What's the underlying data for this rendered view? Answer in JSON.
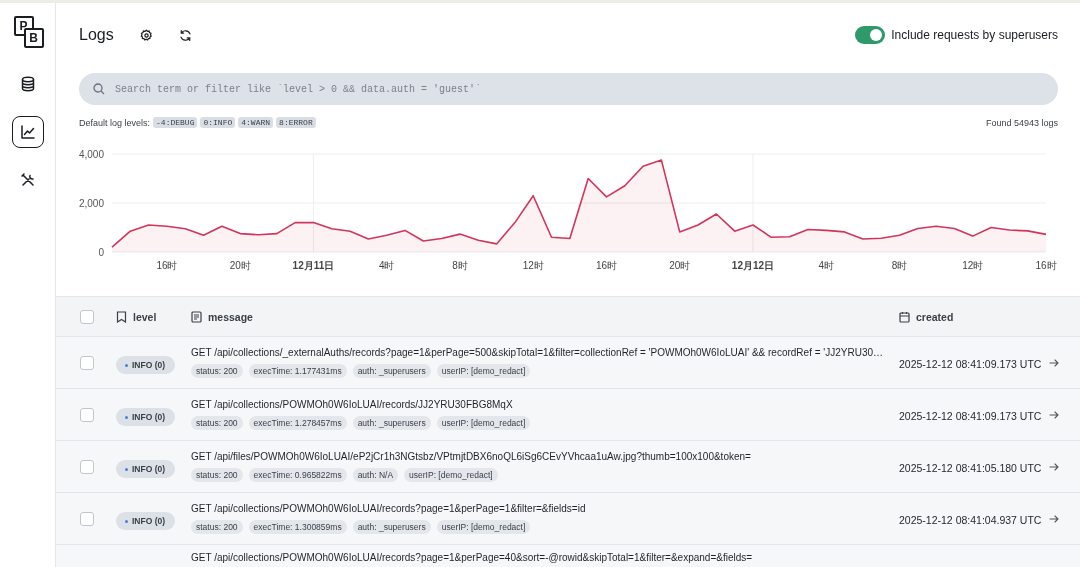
{
  "logo": {
    "top": "P",
    "bottom": "B"
  },
  "sidebar": {
    "items": [
      {
        "kind": "database",
        "selected": false
      },
      {
        "kind": "chart",
        "selected": true
      },
      {
        "kind": "tools",
        "selected": false
      }
    ]
  },
  "header": {
    "title": "Logs"
  },
  "toggle": {
    "label": "Include requests by superusers",
    "on": true
  },
  "search": {
    "placeholder": "Search term or filter like `level > 0 && data.auth = 'guest'`"
  },
  "levels": {
    "label": "Default log levels:",
    "chips": [
      "-4:DEBUG",
      "0:INFO",
      "4:WARN",
      "8:ERROR"
    ]
  },
  "found": "Found 54943 logs",
  "chart_data": {
    "type": "area",
    "categories": [
      null,
      null,
      null,
      "16时",
      null,
      null,
      null,
      "20时",
      null,
      null,
      null,
      "12月11日",
      null,
      null,
      null,
      "4时",
      null,
      null,
      null,
      "8时",
      null,
      null,
      null,
      "12时",
      null,
      null,
      null,
      "16时",
      null,
      null,
      null,
      "20时",
      null,
      null,
      null,
      "12月12日",
      null,
      null,
      null,
      "4时",
      null,
      null,
      null,
      "8时",
      null,
      null,
      null,
      "12时",
      null,
      null,
      null,
      "16时"
    ],
    "series": [
      {
        "color": "#d1355b",
        "values": [
          200,
          850,
          1100,
          1050,
          950,
          680,
          1050,
          750,
          700,
          750,
          1200,
          1200,
          950,
          850,
          530,
          680,
          880,
          450,
          550,
          730,
          480,
          330,
          1200,
          2300,
          600,
          550,
          3000,
          2250,
          2700,
          3500,
          3750,
          820,
          1100,
          1550,
          850,
          1100,
          600,
          620,
          920,
          880,
          820,
          530,
          560,
          680,
          960,
          1050,
          960,
          650,
          1000,
          900,
          860,
          720
        ]
      }
    ],
    "ylim": [
      0,
      4000
    ],
    "grid": true,
    "yticks": [
      {
        "value": 0,
        "label": "0"
      },
      {
        "value": 2000,
        "label": "2,000"
      },
      {
        "value": 4000,
        "label": "4,000"
      }
    ]
  },
  "table": {
    "header_checked": false,
    "columns": [
      {
        "kind": "level",
        "label": "level"
      },
      {
        "kind": "message",
        "label": "message"
      },
      {
        "kind": "created",
        "label": "created"
      }
    ],
    "rows": [
      {
        "selected": false,
        "level": "INFO (0)",
        "message": "GET /api/collections/_externalAuths/records?page=1&perPage=500&skipTotal=1&filter=collectionRef = 'POWMOh0W6IoLUAI' && recordRef = 'JJ2YRU30…",
        "tags": [
          "status: 200",
          "execTime: 1.177431ms",
          "auth: _superusers",
          "userIP: [demo_redact]"
        ],
        "created": "2025-12-12 08:41:09.173 UTC"
      },
      {
        "selected": false,
        "level": "INFO (0)",
        "message": "GET /api/collections/POWMOh0W6IoLUAI/records/JJ2YRU30FBG8MqX",
        "tags": [
          "status: 200",
          "execTime: 1.278457ms",
          "auth: _superusers",
          "userIP: [demo_redact]"
        ],
        "created": "2025-12-12 08:41:09.173 UTC"
      },
      {
        "selected": false,
        "level": "INFO (0)",
        "message": "GET /api/files/POWMOh0W6IoLUAI/eP2jCr1h3NGtsbz/VPtmjtDBX6noQL6iSg6CEvYVhcaa1uAw.jpg?thumb=100x100&token=",
        "tags": [
          "status: 200",
          "execTime: 0.965822ms",
          "auth: N/A",
          "userIP: [demo_redact]"
        ],
        "created": "2025-12-12 08:41:05.180 UTC"
      },
      {
        "selected": false,
        "level": "INFO (0)",
        "message": "GET /api/collections/POWMOh0W6IoLUAI/records?page=1&perPage=1&filter=&fields=id",
        "tags": [
          "status: 200",
          "execTime: 1.300859ms",
          "auth: _superusers",
          "userIP: [demo_redact]"
        ],
        "created": "2025-12-12 08:41:04.937 UTC"
      },
      {
        "message": "GET /api/collections/POWMOh0W6IoLUAI/records?page=1&perPage=40&sort=-@rowid&skipTotal=1&filter=&expand=&fields="
      }
    ]
  }
}
